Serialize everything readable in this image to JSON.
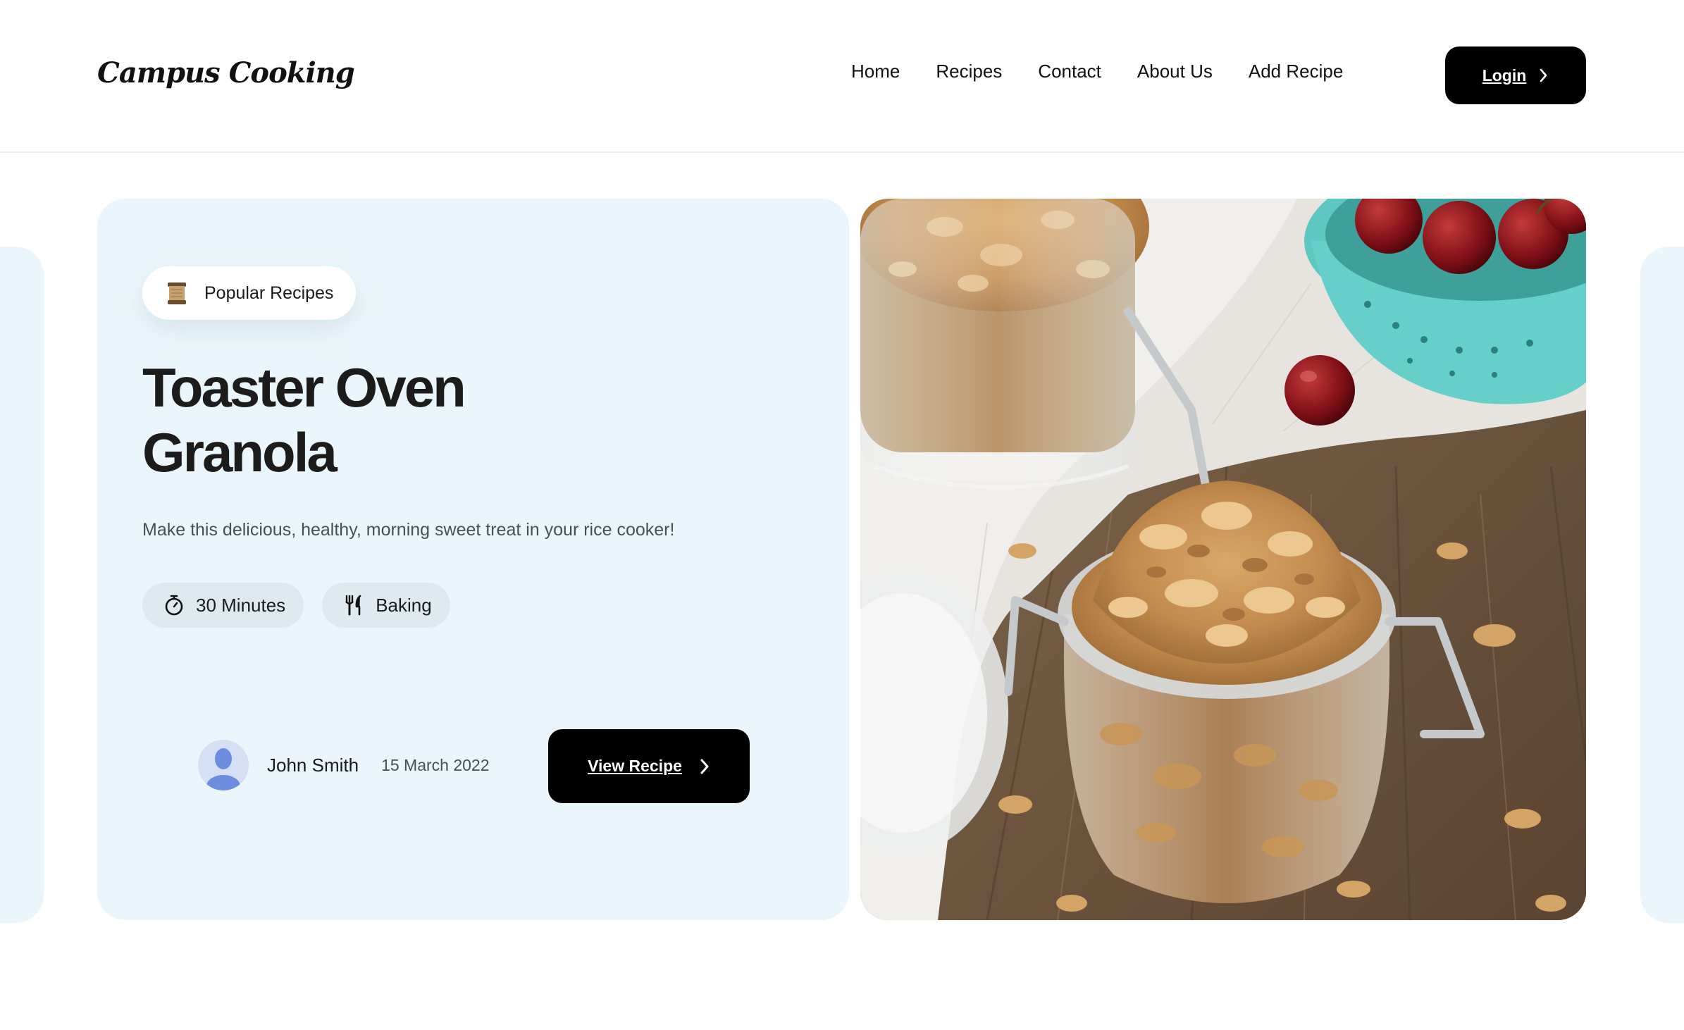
{
  "header": {
    "logo": "Campus Cooking",
    "nav": [
      {
        "label": "Home"
      },
      {
        "label": "Recipes"
      },
      {
        "label": "Contact"
      },
      {
        "label": "About Us"
      },
      {
        "label": "Add Recipe"
      }
    ],
    "login_label": "Login"
  },
  "hero": {
    "badge": {
      "icon": "scroll-icon",
      "label": "Popular Recipes"
    },
    "title_line1": "Toaster Oven",
    "title_line2": "Granola",
    "description": "Make this delicious, healthy, morning sweet treat in your rice cooker!",
    "chips": [
      {
        "icon": "timer-icon",
        "label": "30 Minutes"
      },
      {
        "icon": "utensils-icon",
        "label": "Baking"
      }
    ],
    "author": {
      "name": "John Smith",
      "date": "15 March 2022"
    },
    "cta_label": "View Recipe",
    "image": {
      "subject": "granola in glass jars with cherries"
    }
  },
  "colors": {
    "card_bg": "#eaf6fb",
    "button_bg": "#000000",
    "chip_bg": "#dfeaf0",
    "text": "#1a1a1a"
  }
}
